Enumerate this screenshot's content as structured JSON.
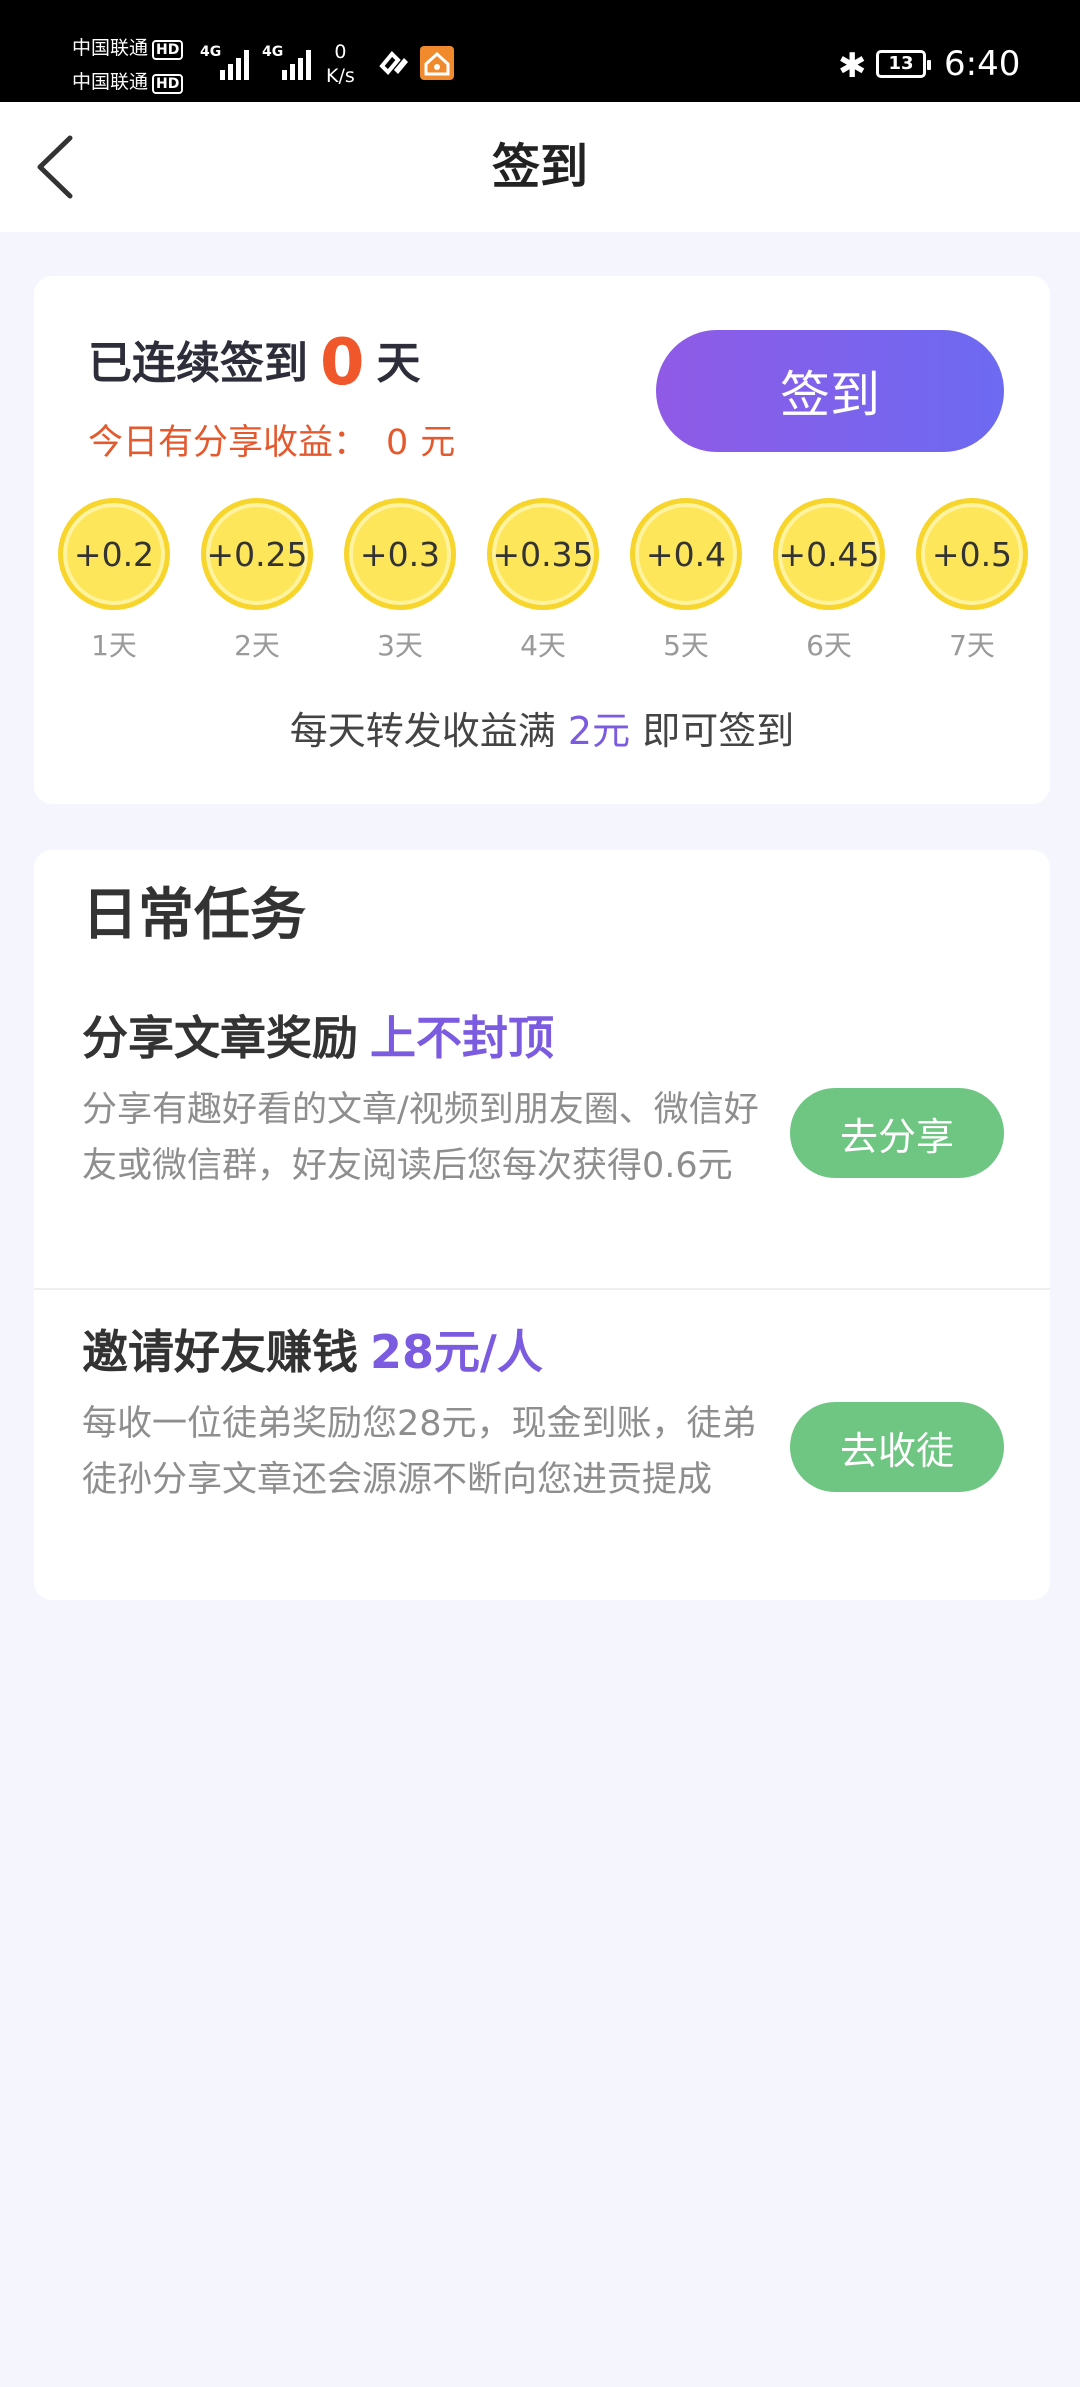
{
  "status_bar": {
    "carrier1": "中国联通",
    "carrier2": "中国联通",
    "hd": "HD",
    "net1": "4G",
    "net2": "4G",
    "speed_value": "0",
    "speed_unit": "K/s",
    "battery": "13",
    "time": "6:40"
  },
  "nav": {
    "title": "签到"
  },
  "checkin": {
    "streak_prefix": "已连续签到",
    "streak_days": "0",
    "streak_suffix": "天",
    "earn_prefix": "今日有分享收益：",
    "earn_value": "0",
    "earn_unit": "元",
    "button_label": "签到",
    "rewards": [
      {
        "amount": "+0.2",
        "day": "1天"
      },
      {
        "amount": "+0.25",
        "day": "2天"
      },
      {
        "amount": "+0.3",
        "day": "3天"
      },
      {
        "amount": "+0.35",
        "day": "4天"
      },
      {
        "amount": "+0.4",
        "day": "5天"
      },
      {
        "amount": "+0.45",
        "day": "6天"
      },
      {
        "amount": "+0.5",
        "day": "7天"
      }
    ],
    "rule_prefix": "每天转发收益满",
    "rule_amount": "2元",
    "rule_suffix": "即可签到"
  },
  "tasks": {
    "title": "日常任务",
    "items": [
      {
        "title": "分享文章奖励",
        "highlight": "上不封顶",
        "desc": "分享有趣好看的文章/视频到朋友圈、微信好友或微信群，好友阅读后您每次获得0.6元",
        "button": "去分享"
      },
      {
        "title": "邀请好友赚钱",
        "highlight": "28元/人",
        "desc": "每收一位徒弟奖励您28元，现金到账，徒弟徒孙分享文章还会源源不断向您进贡提成",
        "button": "去收徒"
      }
    ]
  },
  "colors": {
    "accent_purple": "#7b5be0",
    "earn_orange": "#f0572b",
    "task_button_green": "#6ec682",
    "coin_yellow": "#fde65a"
  }
}
